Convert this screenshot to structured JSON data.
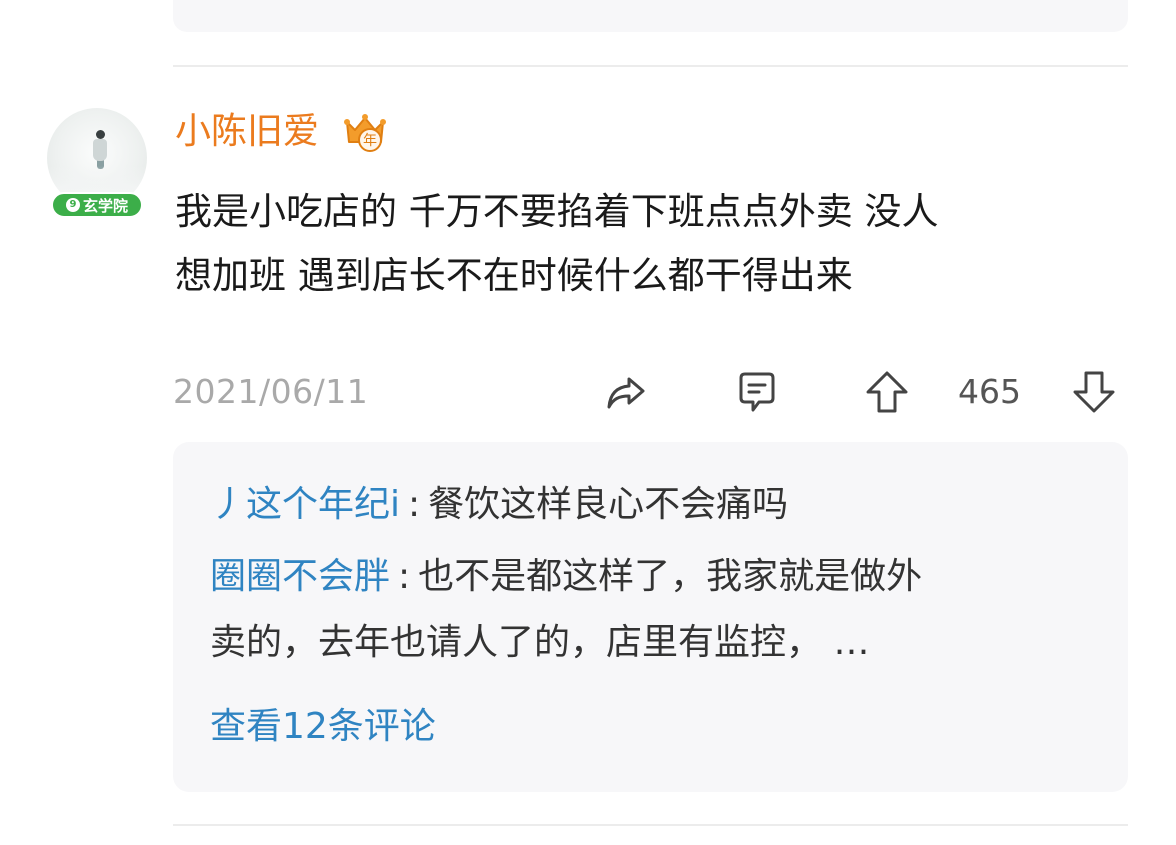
{
  "comment": {
    "username": "小陈旧爱",
    "badge": "玄学院",
    "text_lines": [
      "我是小吃店的 千万不要掐着下班点点外卖 没人",
      "想加班  遇到店长不在时候什么都干得出来"
    ],
    "date": "2021/06/11",
    "like_count": "465"
  },
  "replies": [
    {
      "name": "丿这个年纪i",
      "separator": ":",
      "lines": [
        "餐饮这样良心不会痛吗"
      ]
    },
    {
      "name": "圈圈不会胖",
      "separator": ":",
      "lines": [
        "也不是都这样了，我家就是做外",
        "卖的，去年也请人了的，店里有监控，  …"
      ]
    }
  ],
  "view_all_label": "查看12条评论",
  "icons": {
    "share": "share-icon",
    "comment": "comment-icon",
    "upvote": "upvote-icon",
    "downvote": "downvote-icon",
    "vip": "crown-year-icon"
  },
  "colors": {
    "username": "#eb7b1e",
    "reply_name": "#2f84c2",
    "badge": "#3cae49",
    "reply_bg": "#f7f7f9"
  }
}
